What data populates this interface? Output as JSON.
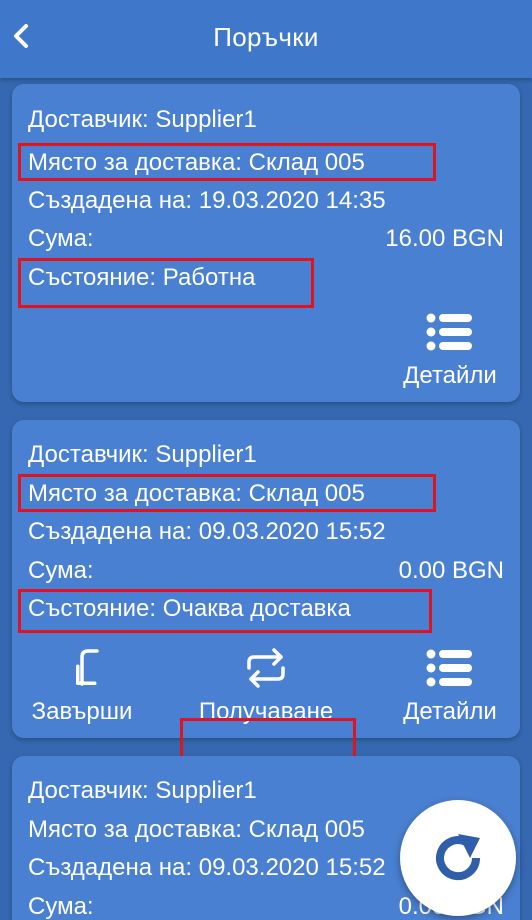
{
  "app_bar": {
    "title": "Поръчки"
  },
  "orders": [
    {
      "supplier": "Доставчик: Supplier1",
      "delivery_place": "Място за доставка: Склад 005",
      "created": "Създадена на: 19.03.2020 14:35",
      "amount_label": "Сума:",
      "amount_value": "16.00 BGN",
      "status": "Състояние: Работна",
      "actions": {
        "details": "Детайли"
      }
    },
    {
      "supplier": "Доставчик: Supplier1",
      "delivery_place": "Място за доставка: Склад 005",
      "created": "Създадена на: 09.03.2020 15:52",
      "amount_label": "Сума:",
      "amount_value": "0.00 BGN",
      "status": "Състояние: Очаква доставка",
      "actions": {
        "complete": "Завърши",
        "receive": "Получаване",
        "details": "Детайли"
      }
    },
    {
      "supplier": "Доставчик: Supplier1",
      "delivery_place": "Място за доставка: Склад 005",
      "created": "Създадена на: 09.03.2020 15:52",
      "amount_label": "Сума:",
      "amount_value": "0.00 BGN"
    }
  ],
  "colors": {
    "background": "#3568b0",
    "app_bar": "#3f78cb",
    "card": "#4a80d1",
    "highlight": "#e0141e",
    "text": "#ffffff",
    "fab_background": "#ffffff",
    "fab_icon": "#2f5fa8"
  },
  "icons": {
    "back": "chevron-left-icon",
    "details": "list-icon",
    "complete": "turn-down-left-arrow-icon",
    "receive": "repeat-arrows-icon",
    "refresh": "refresh-icon"
  }
}
